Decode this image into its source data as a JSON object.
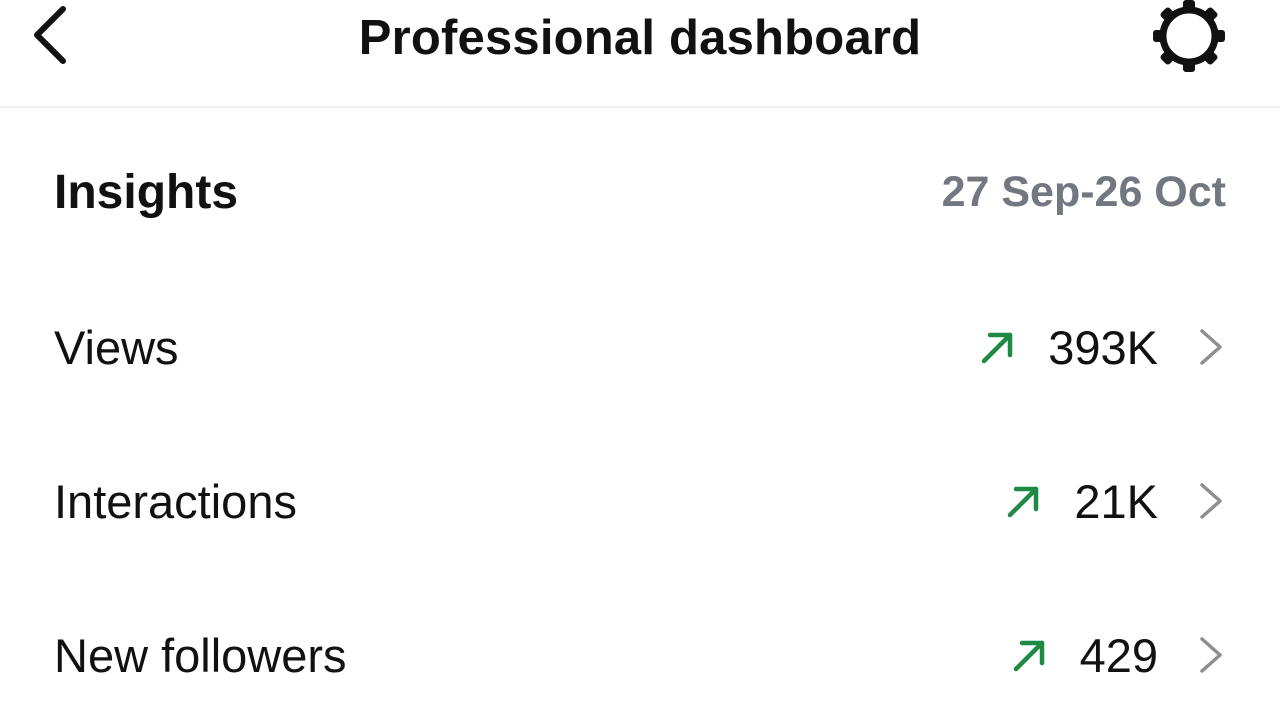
{
  "header": {
    "title": "Professional dashboard",
    "back_icon": "chevron-left-icon",
    "settings_icon": "gear-icon"
  },
  "insights": {
    "title": "Insights",
    "date_range": "27 Sep-26 Oct",
    "rows": [
      {
        "label": "Views",
        "value": "393K",
        "trend": "up"
      },
      {
        "label": "Interactions",
        "value": "21K",
        "trend": "up"
      },
      {
        "label": "New followers",
        "value": "429",
        "trend": "up"
      }
    ]
  },
  "colors": {
    "trend_up": "#1e8a43",
    "muted_text": "#737780",
    "chevron": "#8e8e93",
    "divider": "#efefef"
  }
}
